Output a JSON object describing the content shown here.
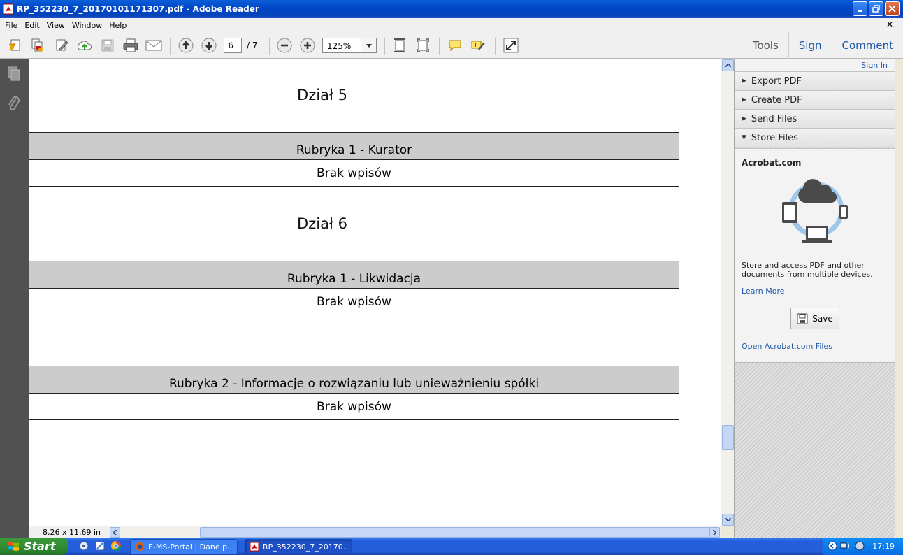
{
  "window": {
    "title": "RP_352230_7_20170101171307.pdf - Adobe Reader"
  },
  "menu": [
    "File",
    "Edit",
    "View",
    "Window",
    "Help"
  ],
  "toolbar": {
    "page_current": "6",
    "page_total": "/ 7",
    "zoom": "125%",
    "tabs": {
      "tools": "Tools",
      "sign": "Sign",
      "comment": "Comment"
    }
  },
  "document": {
    "sections": [
      {
        "heading": "Dział 5"
      },
      {
        "heading": "Dział 6"
      }
    ],
    "rubrics": [
      {
        "title": "Rubryka 1 - Kurator",
        "body": "Brak wpisów"
      },
      {
        "title": "Rubryka 1 - Likwidacja",
        "body": "Brak wpisów"
      },
      {
        "title": "Rubryka 2 - Informacje o rozwiązaniu lub unieważnieniu spółki",
        "body": "Brak wpisów"
      }
    ],
    "page_size": "8,26 x 11,69 in"
  },
  "panel": {
    "sign_in": "Sign In",
    "sections": [
      "Export PDF",
      "Create PDF",
      "Send Files",
      "Store Files"
    ],
    "store": {
      "service": "Acrobat.com",
      "description": "Store and access PDF and other documents from multiple devices.",
      "learn_more": "Learn More",
      "save": "Save",
      "open_files": "Open Acrobat.com Files"
    }
  },
  "taskbar": {
    "start": "Start",
    "tasks": [
      "E-MS-Portal | Dane p...",
      "RP_352230_7_20170..."
    ],
    "clock": "17:19"
  },
  "colors": {
    "titlebar": "#0046c7",
    "link": "#1e57a8",
    "rubric_header": "#cccccc"
  }
}
